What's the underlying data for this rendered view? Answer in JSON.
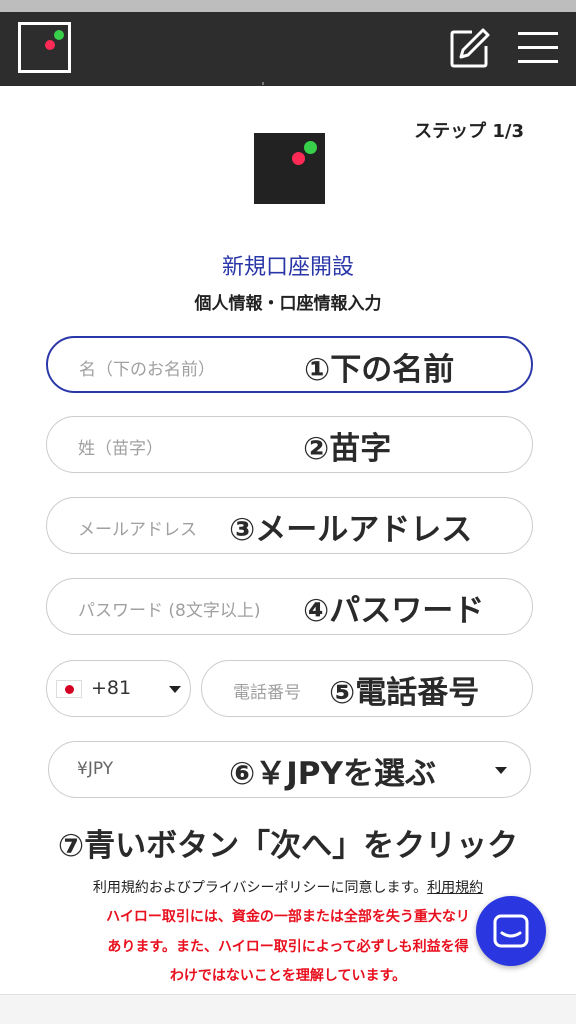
{
  "header": {
    "logo": "app-logo",
    "edit_icon": "edit-icon",
    "menu_icon": "hamburger-menu-icon"
  },
  "step": "ステップ 1/3",
  "title": "新規口座開設",
  "subtitle": "個人情報・口座情報入力",
  "fields": {
    "first_name": {
      "placeholder": "名（下のお名前）",
      "annotation": "①下の名前"
    },
    "last_name": {
      "placeholder": "姓（苗字）",
      "annotation": "②苗字"
    },
    "email": {
      "placeholder": "メールアドレス",
      "annotation": "③メールアドレス"
    },
    "password": {
      "placeholder": "パスワード (8文字以上)",
      "annotation": "④パスワード"
    },
    "country_code": {
      "value": "+81"
    },
    "phone": {
      "placeholder": "電話番号",
      "annotation": "⑤電話番号"
    },
    "currency": {
      "value": "¥JPY",
      "annotation": "⑥￥JPYを選ぶ"
    }
  },
  "instruction": "⑦青いボタン「次へ」をクリック",
  "terms": {
    "text": "利用規約およびプライバシーポリシーに同意します。",
    "link": "利用規約"
  },
  "warning": [
    "ハイロー取引には、資金の一部または全部を失う重大なリ",
    "あります。また、ハイロー取引によって必ずしも利益を得",
    "わけではないことを理解しています。"
  ],
  "colors": {
    "accent": "#2a37a8",
    "warning": "#e8101e",
    "chat": "#2a37e0",
    "header": "#2d2d2d"
  }
}
